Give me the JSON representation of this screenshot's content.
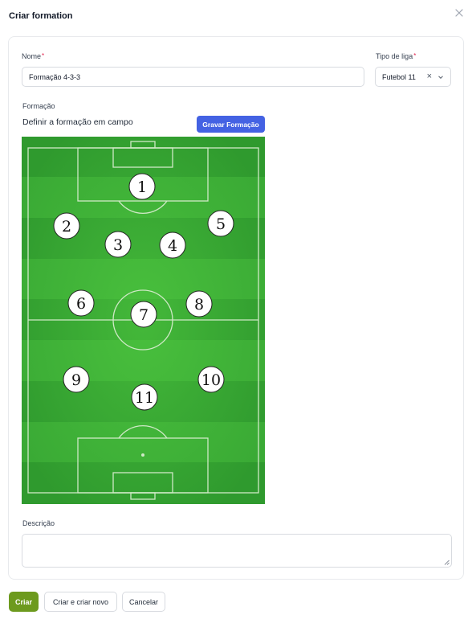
{
  "modal": {
    "title": "Criar formation",
    "close_icon": "close-icon"
  },
  "form": {
    "name_label": "Nome",
    "name_value": "Formação 4-3-3",
    "required_mark": "*",
    "league_label": "Tipo de liga",
    "league_value": "Futebol 11",
    "clear_symbol": "×",
    "formation_label": "Formação",
    "formation_hint": "Definir a formação em campo",
    "record_button": "Gravar Formação",
    "description_label": "Descrição",
    "description_value": ""
  },
  "pitch": {
    "colors": {
      "dark": "#2f9a2e",
      "light": "#3aaa35",
      "center": "#4fc63e",
      "lines": "#cfe9c6"
    },
    "players": [
      {
        "number": "1"
      },
      {
        "number": "2"
      },
      {
        "number": "3"
      },
      {
        "number": "4"
      },
      {
        "number": "5"
      },
      {
        "number": "6"
      },
      {
        "number": "7"
      },
      {
        "number": "8"
      },
      {
        "number": "9"
      },
      {
        "number": "10"
      },
      {
        "number": "11"
      }
    ]
  },
  "footer": {
    "create": "Criar",
    "create_and_new": "Criar e criar novo",
    "cancel": "Cancelar"
  },
  "colors": {
    "primary": "#6d9a1e",
    "accent_blue": "#4462e3",
    "required": "#e11d48"
  }
}
